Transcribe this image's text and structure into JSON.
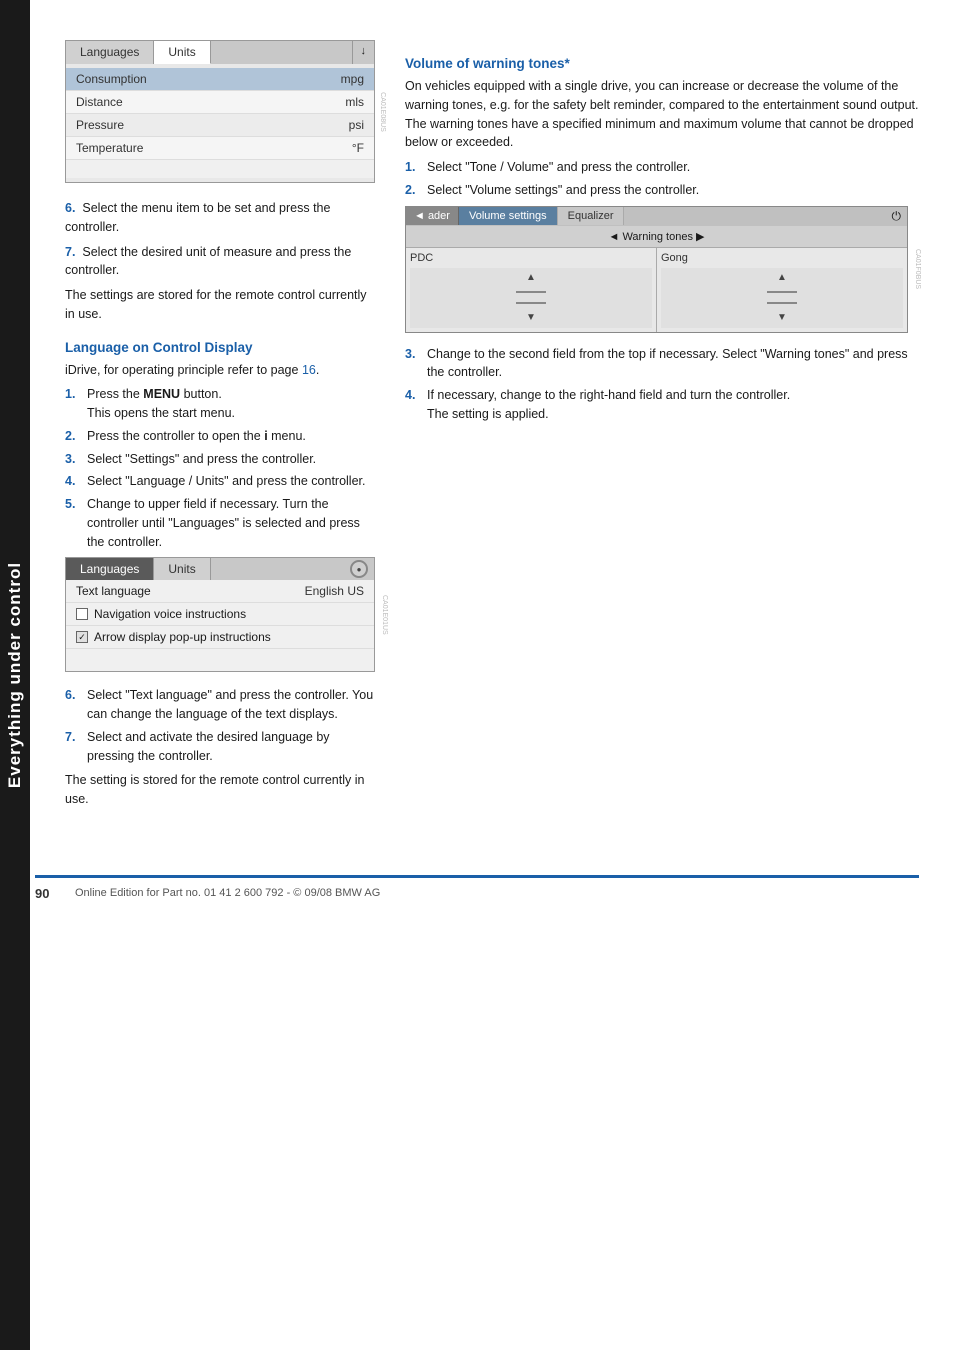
{
  "sidebar": {
    "label": "Everything under control"
  },
  "left_column": {
    "units_box": {
      "tab_languages": "Languages",
      "tab_units": "Units",
      "icon": "↓",
      "rows": [
        {
          "label": "Consumption",
          "value": "mpg"
        },
        {
          "label": "Distance",
          "value": "mls"
        },
        {
          "label": "Pressure",
          "value": "psi"
        },
        {
          "label": "Temperature",
          "value": "°F"
        }
      ]
    },
    "step6_text": "Select the menu item to be set and press the controller.",
    "step7_text": "Select the desired unit of measure and press the controller.",
    "settings_note": "The settings are stored for the remote control currently in use.",
    "section_heading": "Language on Control Display",
    "idrive_text": "iDrive, for operating principle refer to page 16.",
    "steps": [
      {
        "num": "1.",
        "text": "Press the MENU button.\nThis opens the start menu."
      },
      {
        "num": "2.",
        "text": "Press the controller to open the i menu."
      },
      {
        "num": "3.",
        "text": "Select \"Settings\" and press the controller."
      },
      {
        "num": "4.",
        "text": "Select \"Language / Units\" and press the controller."
      },
      {
        "num": "5.",
        "text": "Change to upper field if necessary. Turn the controller until \"Languages\" is selected and press the controller."
      }
    ],
    "lang_box": {
      "tab_languages": "Languages",
      "tab_units": "Units",
      "icon": "●",
      "lang_row_label": "Text language",
      "lang_row_value": "English US",
      "checkbox1_label": "Navigation voice instructions",
      "checkbox1_checked": false,
      "checkbox2_label": "Arrow display pop-up instructions",
      "checkbox2_checked": true
    },
    "steps2": [
      {
        "num": "6.",
        "text": "Select \"Text language\" and press the controller. You can change the language of the text displays."
      },
      {
        "num": "7.",
        "text": "Select and activate the desired language by pressing the controller."
      }
    ],
    "final_note": "The setting is stored for the remote control currently in use."
  },
  "right_column": {
    "volume_heading": "Volume of warning tones*",
    "volume_intro": "On vehicles equipped with a single drive, you can increase or decrease the volume of the warning tones, e.g. for the safety belt reminder, compared to the entertainment sound output. The warning tones have a specified minimum and maximum volume that cannot be dropped below or exceeded.",
    "steps": [
      {
        "num": "1.",
        "text": "Select \"Tone / Volume\" and press the controller."
      },
      {
        "num": "2.",
        "text": "Select \"Volume settings\" and press the controller."
      }
    ],
    "vol_box": {
      "back_label": "◄ ader",
      "tab_volume": "Volume settings",
      "tab_equalizer": "Equalizer",
      "icon": "⏻",
      "subtitle": "◄ Warning tones ▶",
      "channel1_name": "PDC",
      "channel2_name": "Gong"
    },
    "steps2": [
      {
        "num": "3.",
        "text": "Change to the second field from the top if necessary. Select \"Warning tones\" and press the controller."
      },
      {
        "num": "4.",
        "text": "If necessary, change to the right-hand field and turn the controller.\nThe setting is applied."
      }
    ]
  },
  "footer": {
    "page_number": "90",
    "text": "Online Edition for Part no. 01 41 2 600 792 - © 09/08 BMW AG"
  }
}
